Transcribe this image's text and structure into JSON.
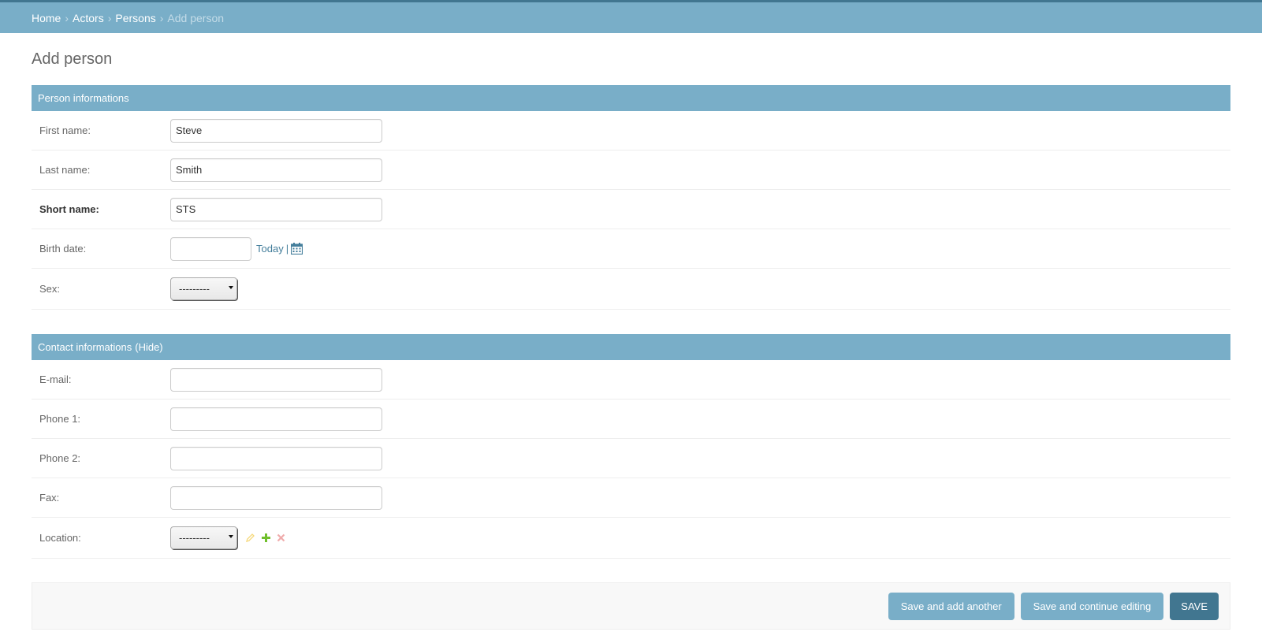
{
  "breadcrumbs": {
    "home": "Home",
    "actors": "Actors",
    "persons": "Persons",
    "current": "Add person",
    "separator": "›"
  },
  "page_title": "Add person",
  "person_section": {
    "title": "Person informations",
    "first_name": {
      "label": "First name:",
      "value": "Steve"
    },
    "last_name": {
      "label": "Last name:",
      "value": "Smith"
    },
    "short_name": {
      "label": "Short name:",
      "value": "STS"
    },
    "birth_date": {
      "label": "Birth date:",
      "value": "",
      "today_link": "Today",
      "pipe": "|"
    },
    "sex": {
      "label": "Sex:",
      "selected": "---------"
    }
  },
  "contact_section": {
    "title": "Contact informations",
    "toggle": "(Hide)",
    "email": {
      "label": "E-mail:",
      "value": ""
    },
    "phone1": {
      "label": "Phone 1:",
      "value": ""
    },
    "phone2": {
      "label": "Phone 2:",
      "value": ""
    },
    "fax": {
      "label": "Fax:",
      "value": ""
    },
    "location": {
      "label": "Location:",
      "selected": "---------"
    }
  },
  "submit": {
    "save_add_another": "Save and add another",
    "save_continue": "Save and continue editing",
    "save": "SAVE"
  },
  "colors": {
    "header": "#79aec8",
    "topline": "#417690",
    "link": "#447e9b",
    "edit_icon": "#efb80b",
    "add_icon": "#70bf2b",
    "delete_icon": "#dd4646"
  }
}
